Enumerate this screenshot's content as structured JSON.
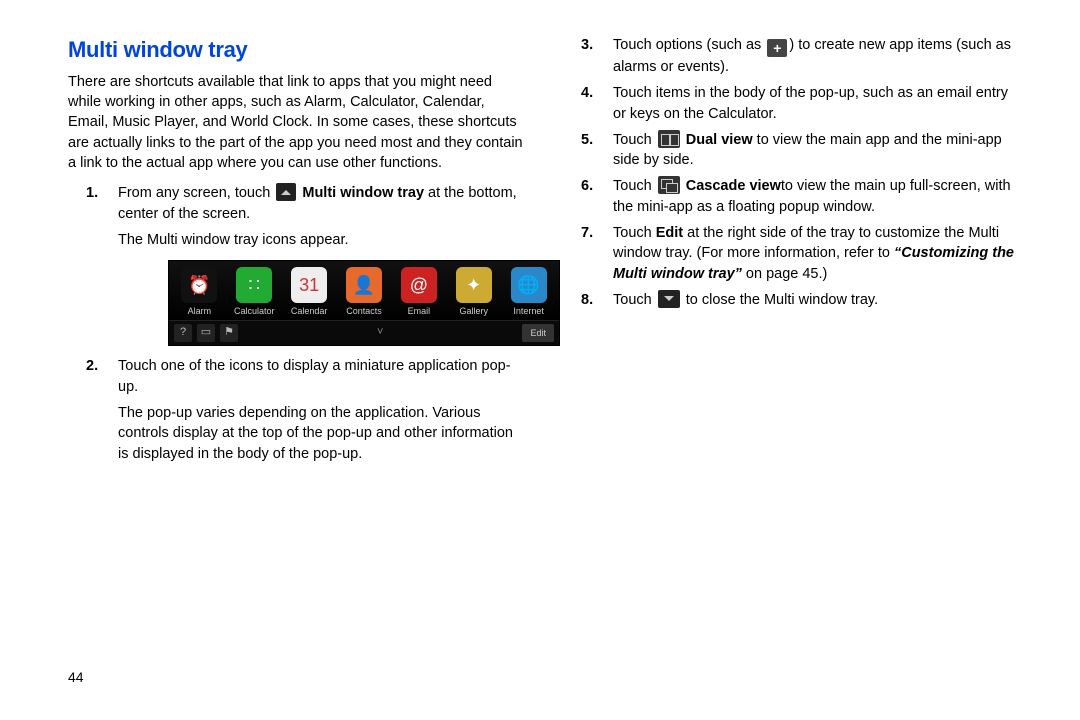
{
  "title": "Multi window tray",
  "intro": "There are shortcuts available that link to apps that you might need while working in other apps, such as Alarm, Calculator, Calendar, Email, Music Player, and World Clock. In some cases, these shortcuts are actually links to the part of the app you need most and they contain a link to the actual app where you can use other functions.",
  "pageNumber": "44",
  "steps": {
    "s1": {
      "num": "1.",
      "a": "From any screen, touch ",
      "b": " Multi window tray",
      "c": " at the bottom, center of the screen.",
      "sub": "The Multi window tray icons appear."
    },
    "s2": {
      "num": "2.",
      "a": "Touch one of the icons to display a miniature application pop-up.",
      "sub": "The pop-up varies depending on the application. Various controls display at the top of the pop-up and other information is displayed in the body of the pop-up."
    },
    "s3": {
      "num": "3.",
      "a": "Touch options (such as ",
      "b": ") to create new app items (such as alarms or events)."
    },
    "s4": {
      "num": "4.",
      "a": "Touch items in the body of the pop-up, such as an email entry or keys on the Calculator."
    },
    "s5": {
      "num": "5.",
      "a": "Touch ",
      "b": " Dual view",
      "c": " to view the main app and the mini-app side by side."
    },
    "s6": {
      "num": "6.",
      "a": "Touch ",
      "b": " Cascade view",
      "c": "to view the main up full-screen, with the mini-app as a floating popup window."
    },
    "s7": {
      "num": "7.",
      "a": "Touch ",
      "b": "Edit",
      "c": " at the right side of the tray to customize the Multi window tray. (For more information, refer to ",
      "ref": "“Customizing the Multi window tray”",
      "d": " on page 45.)"
    },
    "s8": {
      "num": "8.",
      "a": "Touch ",
      "b": " to close the Multi window tray."
    }
  },
  "tray": {
    "apps": [
      {
        "label": "Alarm",
        "bg": "#111",
        "glyph": "⏰"
      },
      {
        "label": "Calculator",
        "bg": "#2a3",
        "glyph": "∷"
      },
      {
        "label": "Calendar",
        "bg": "#eee",
        "glyph": "31",
        "fg": "#c33"
      },
      {
        "label": "Contacts",
        "bg": "#e66a2b",
        "glyph": "👤"
      },
      {
        "label": "Email",
        "bg": "#c22",
        "glyph": "@"
      },
      {
        "label": "Gallery",
        "bg": "#ca3",
        "glyph": "✦"
      },
      {
        "label": "Internet",
        "bg": "#2a88c8",
        "glyph": "🌐"
      }
    ],
    "edit": "Edit"
  },
  "icons": {
    "plus": "+"
  }
}
